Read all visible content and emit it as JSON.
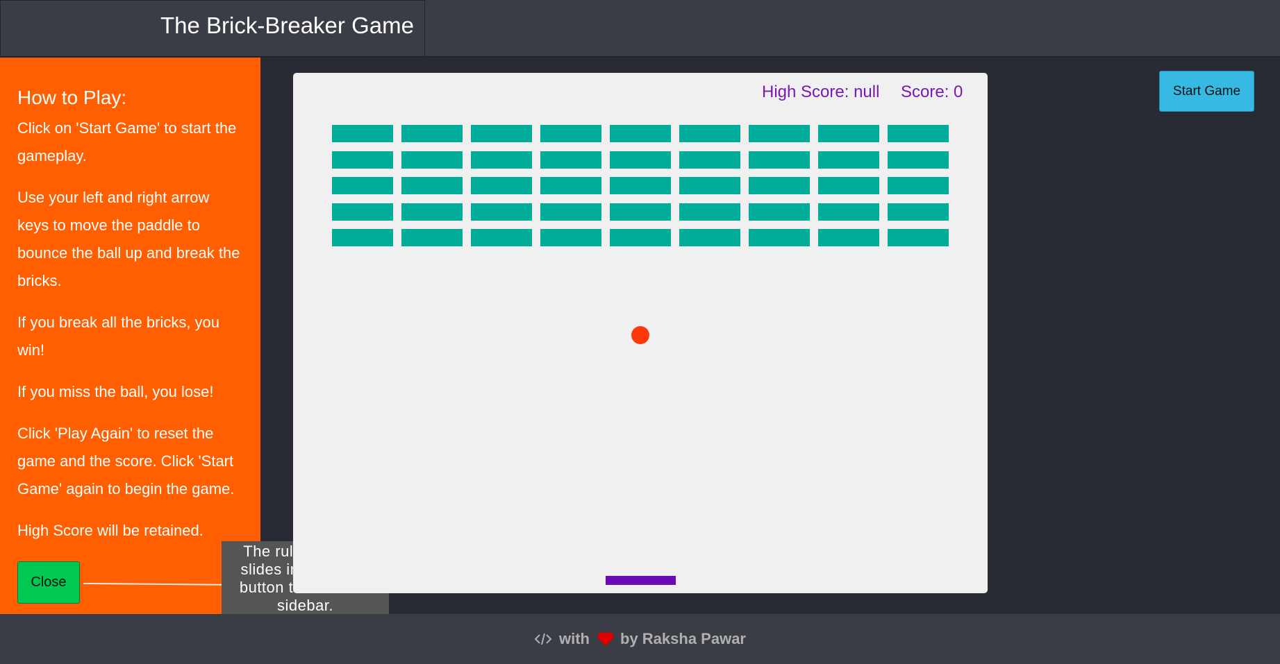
{
  "header": {
    "title": "The Brick-Breaker Game"
  },
  "sidebar": {
    "heading": "How to Play:",
    "paragraphs": [
      "Click on 'Start Game' to start the gameplay.",
      "Use your left and right arrow keys to move the paddle to bounce the ball up and break the bricks.",
      "If you break all the bricks, you win!",
      "If you miss the ball, you lose!",
      "Click 'Play Again' to reset the game and the score. Click 'Start Game' again to begin the game.",
      "High Score will be retained."
    ],
    "close_label": "Close"
  },
  "tooltip": {
    "text": "The rules sidebar slides in. Click the button to close the sidebar."
  },
  "game": {
    "high_score_label": "High Score:",
    "high_score_value": "null",
    "score_label": "Score:",
    "score_value": "0",
    "brick_rows": 5,
    "brick_columns": 9,
    "colors": {
      "brick": "#00ad9a",
      "ball": "#ff3a0a",
      "paddle": "#6a0bb5",
      "score_text": "#7a19b0",
      "canvas": "#f0f0f0"
    }
  },
  "controls": {
    "start_label": "Start Game"
  },
  "footer": {
    "with_text": "with",
    "author_text": "by Raksha Pawar",
    "code_icon": "code-icon",
    "heart_icon": "heart-icon",
    "heart_color": "#e00000"
  },
  "colors": {
    "background": "#282b33",
    "header": "#3a3d46",
    "sidebar": "#ff5f00",
    "close_button": "#00c853",
    "start_button": "#36b9e2",
    "tooltip": "#555555"
  }
}
